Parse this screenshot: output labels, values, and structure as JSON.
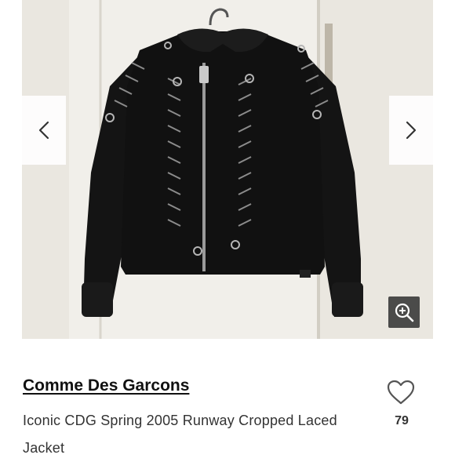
{
  "product": {
    "brand": "Comme Des Garcons",
    "title": "Iconic CDG Spring 2005 Runway Cropped Laced Jacket",
    "likes": "79"
  },
  "gallery": {
    "image": "black-cropped-laced-jacket-photo",
    "prev_icon": "chevron-left-icon",
    "next_icon": "chevron-right-icon",
    "zoom_icon": "zoom-in-icon"
  },
  "actions": {
    "like_icon": "heart-outline-icon"
  },
  "colors": {
    "text_primary": "#111111",
    "text_secondary": "#333333",
    "background": "#ffffff"
  }
}
